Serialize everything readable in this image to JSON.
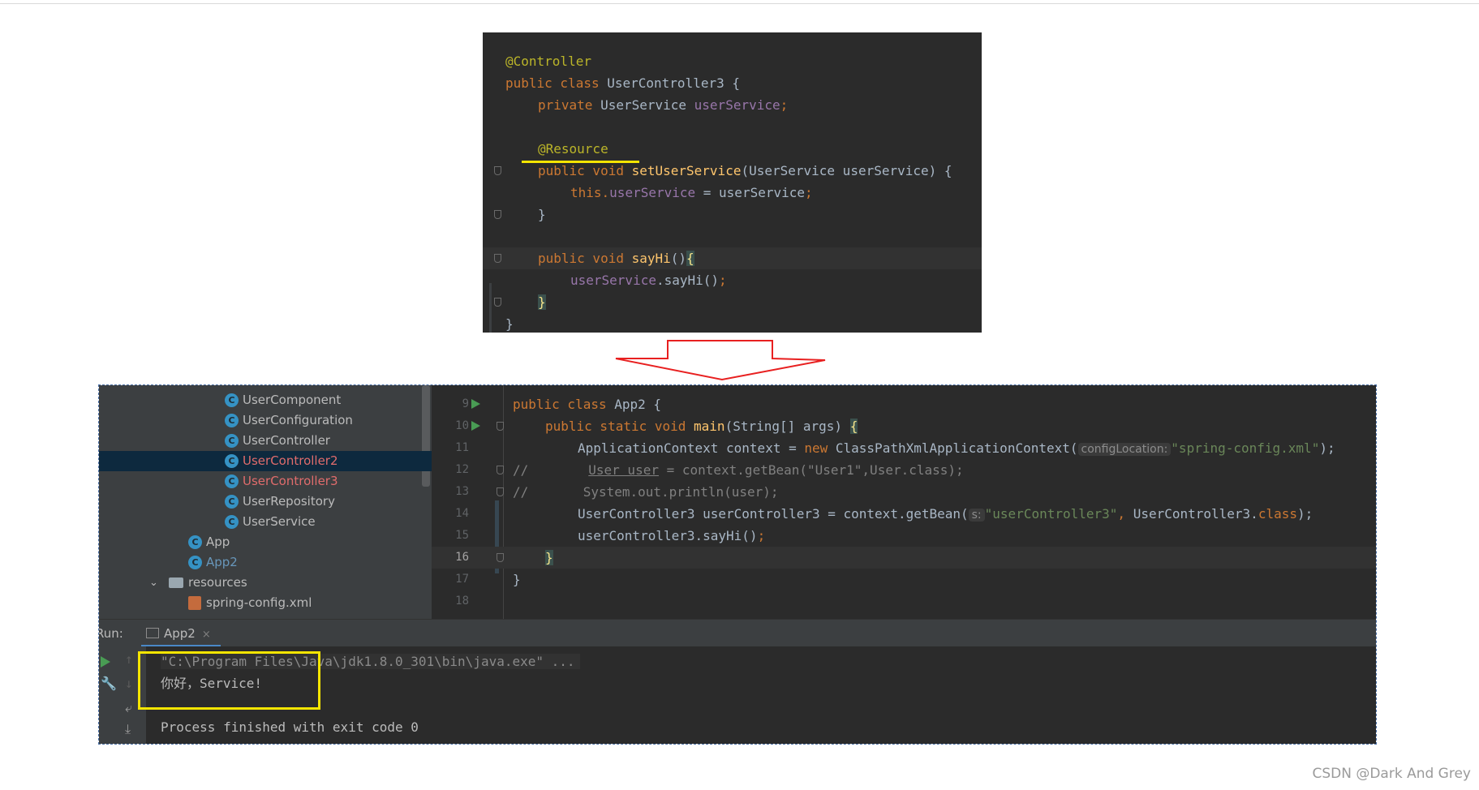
{
  "top_snippet": {
    "lines": [
      {
        "t1": "@Controller"
      },
      {
        "kw": "public class ",
        "rest": "UserController3 {"
      },
      {
        "kw": "private ",
        "type": "UserService ",
        "field": "userService",
        "end": ";"
      },
      {
        "ann": "@Resource"
      },
      {
        "kw": "public void ",
        "fn": "setUserService",
        "rest": "(UserService userService) {"
      },
      {
        "kw": "this.",
        "field": "userService",
        "rest": " = userService",
        "end": ";"
      },
      {
        "rest": "}"
      },
      {
        "kw": "public void ",
        "fn": "sayHi",
        "rest": "()",
        "brace": "{"
      },
      {
        "field": "userService",
        "rest": ".sayHi()",
        "end": ";"
      },
      {
        "brace": "}"
      },
      {
        "rest": "}"
      }
    ]
  },
  "project_tree": {
    "items": [
      {
        "label": "UserComponent"
      },
      {
        "label": "UserConfiguration"
      },
      {
        "label": "UserController"
      },
      {
        "label": "UserController2"
      },
      {
        "label": "UserController3"
      },
      {
        "label": "UserRepository"
      },
      {
        "label": "UserService"
      },
      {
        "label": "App"
      },
      {
        "label": "App2"
      },
      {
        "label": "resources"
      },
      {
        "label": "spring-config.xml"
      }
    ]
  },
  "editor": {
    "line_numbers": [
      "9",
      "10",
      "11",
      "12",
      "13",
      "14",
      "15",
      "16",
      "17",
      "18"
    ],
    "l9": {
      "kw": "public class ",
      "rest": "App2 {"
    },
    "l10": {
      "kw": "public static void ",
      "fn": "main",
      "rest": "(String[] args) ",
      "brace": "{"
    },
    "l11": {
      "rest": "ApplicationContext context = ",
      "kw": "new ",
      "rest2": "ClassPathXmlApplicationContext(",
      "hint": "configLocation:",
      "str": "\"spring-config.xml\"",
      "end": ");"
    },
    "l12": {
      "cmt": "//",
      "cmt2": "User user",
      "cmt3": " = context.getBean(\"User1\",User.class);"
    },
    "l13": {
      "cmt": "//       System.out.println(user);"
    },
    "l14": {
      "rest": "UserController3 userController3 = context.getBean(",
      "hint": "s:",
      "str": "\"userController3\"",
      "kw": ", ",
      "rest2": "UserController3.",
      "kw2": "class",
      "end": ");"
    },
    "l15": {
      "rest": "userController3.sayHi()",
      "end": ";"
    },
    "l16": {
      "brace": "}"
    },
    "l17": {
      "rest": "}"
    }
  },
  "run_panel": {
    "label": "Run:",
    "tab": "App2",
    "tab_close": "×",
    "cmd": "\"C:\\Program Files\\Java\\jdk1.8.0_301\\bin\\java.exe\" ...",
    "output": "你好，Service!",
    "finished": "Process finished with exit code 0"
  },
  "watermark": "CSDN @Dark And Grey"
}
